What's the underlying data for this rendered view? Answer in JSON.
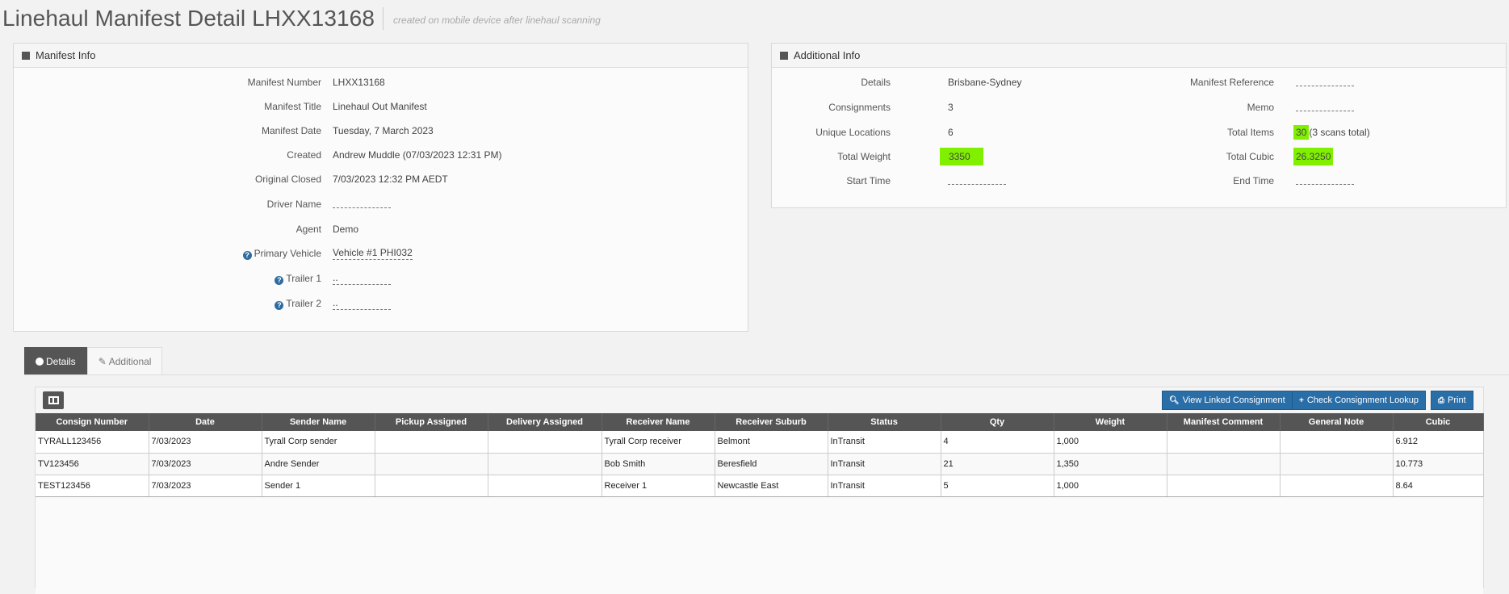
{
  "header": {
    "title": "Linehaul Manifest Detail LHXX13168",
    "subtitle": "created on mobile device after linehaul scanning"
  },
  "manifest_info": {
    "title": "Manifest Info",
    "fields": [
      {
        "label": "Manifest Number",
        "value": "LHXX13168"
      },
      {
        "label": "Manifest Title",
        "value": "Linehaul Out Manifest"
      },
      {
        "label": "Manifest Date",
        "value": "Tuesday, 7 March 2023"
      },
      {
        "label": "Created",
        "value": "Andrew Muddle (07/03/2023 12:31 PM)"
      },
      {
        "label": "Original Closed",
        "value": "7/03/2023 12:32 PM AEDT"
      },
      {
        "label": "Driver Name",
        "value": ""
      },
      {
        "label": "Agent",
        "value": "Demo"
      },
      {
        "label": "Primary Vehicle",
        "value": "Vehicle #1 PHI032"
      },
      {
        "label": "Trailer 1",
        "value": ".."
      },
      {
        "label": "Trailer 2",
        "value": ".."
      }
    ]
  },
  "additional_info": {
    "title": "Additional Info",
    "left": [
      {
        "label": "Details",
        "value": "Brisbane-Sydney"
      },
      {
        "label": "Consignments",
        "value": "3"
      },
      {
        "label": "Unique Locations",
        "value": "6"
      },
      {
        "label": "Total Weight",
        "value": "3350"
      },
      {
        "label": "Start Time",
        "value": ""
      }
    ],
    "right": [
      {
        "label": "Manifest Reference",
        "value": ""
      },
      {
        "label": "Memo",
        "value": ""
      },
      {
        "label": "Total Items",
        "value": "30",
        "suffix": "(3 scans total)"
      },
      {
        "label": "Total Cubic",
        "value": "26.3250"
      },
      {
        "label": "End Time",
        "value": ""
      }
    ],
    "highlight_color": "#80f000"
  },
  "tabs": [
    {
      "label": "Details",
      "active": true
    },
    {
      "label": "Additional",
      "active": false
    }
  ],
  "toolbar": {
    "view_linked": "View Linked Consignment",
    "check_lookup": "Check Consignment Lookup",
    "print": "Print"
  },
  "table": {
    "columns": [
      "Consign Number",
      "Date",
      "Sender Name",
      "Pickup Assigned",
      "Delivery Assigned",
      "Receiver Name",
      "Receiver Suburb",
      "Status",
      "Qty",
      "Weight",
      "Manifest Comment",
      "General Note",
      "Cubic"
    ],
    "rows": [
      [
        "TYRALL123456",
        "7/03/2023",
        "Tyrall Corp sender",
        "",
        "",
        "Tyrall Corp receiver",
        "Belmont",
        "InTransit",
        "4",
        "1,000",
        "",
        "",
        "6.912"
      ],
      [
        "TV123456",
        "7/03/2023",
        "Andre Sender",
        "",
        "",
        "Bob Smith",
        "Beresfield",
        "InTransit",
        "21",
        "1,350",
        "",
        "",
        "10.773"
      ],
      [
        "TEST123456",
        "7/03/2023",
        "Sender 1",
        "",
        "",
        "Receiver 1",
        "Newcastle East",
        "InTransit",
        "5",
        "1,000",
        "",
        "",
        "8.64"
      ]
    ]
  },
  "colors": {
    "primary_button": "#2a6ea8",
    "header_dark": "#555555",
    "help_icon": "#2d6ca2"
  }
}
